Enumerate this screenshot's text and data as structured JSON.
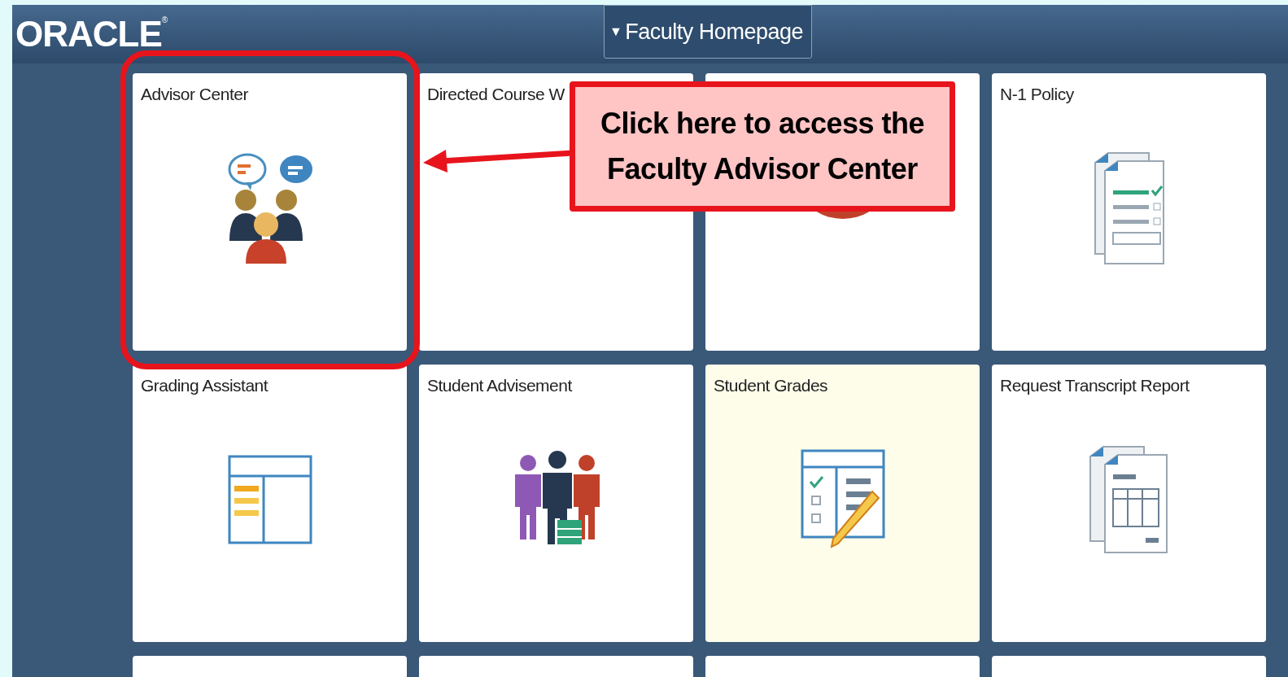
{
  "header": {
    "logo": "ORACLE",
    "logo_mark": "®",
    "page_menu": {
      "arrow": "▼",
      "label": "Faculty Homepage"
    }
  },
  "tiles": [
    {
      "title": "Advisor Center",
      "kind": "advisor",
      "highlighted": false
    },
    {
      "title": "Directed Course W",
      "kind": "blank",
      "highlighted": false
    },
    {
      "kind": "person",
      "highlighted": false
    },
    {
      "title": "N-1 Policy",
      "kind": "policy",
      "highlighted": false
    },
    {
      "title": "Grading Assistant",
      "kind": "grid",
      "highlighted": false
    },
    {
      "title": "Student Advisement",
      "kind": "people",
      "highlighted": false
    },
    {
      "title": "Student Grades",
      "kind": "grades",
      "highlighted": true
    },
    {
      "title": "Request Transcript Report",
      "kind": "report",
      "highlighted": false
    },
    {
      "kind": "blank",
      "highlighted": false
    },
    {
      "kind": "blank",
      "highlighted": false
    },
    {
      "kind": "blank",
      "highlighted": false
    },
    {
      "kind": "blank",
      "highlighted": false
    }
  ],
  "callout": {
    "text": "Click here to access the Faculty Advisor Center"
  }
}
